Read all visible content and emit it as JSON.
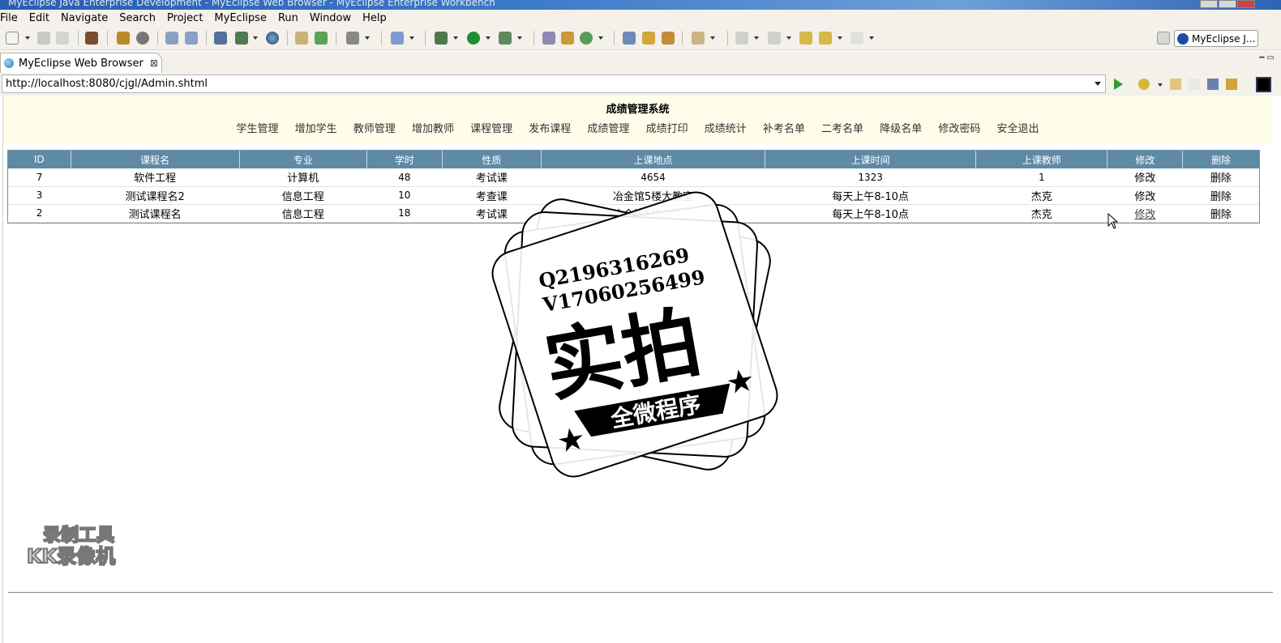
{
  "window": {
    "title": "MyEclipse Java Enterprise Development - MyEclipse Web Browser - MyEclipse Enterprise Workbench"
  },
  "menu": [
    "File",
    "Edit",
    "Navigate",
    "Search",
    "Project",
    "MyEclipse",
    "Run",
    "Window",
    "Help"
  ],
  "perspective": {
    "label": "MyEclipse J..."
  },
  "editor_tab": {
    "label": "MyEclipse Web Browser",
    "close": "⊠"
  },
  "address": {
    "url": "http://localhost:8080/cjgl/Admin.shtml"
  },
  "page": {
    "title": "成绩管理系统",
    "nav": [
      "学生管理",
      "增加学生",
      "教师管理",
      "增加教师",
      "课程管理",
      "发布课程",
      "成绩管理",
      "成绩打印",
      "成绩统计",
      "补考名单",
      "二考名单",
      "降级名单",
      "修改密码",
      "安全退出"
    ]
  },
  "table": {
    "headers": [
      "ID",
      "课程名",
      "专业",
      "学时",
      "性质",
      "上课地点",
      "上课时间",
      "上课教师",
      "修改",
      "删除"
    ],
    "rows": [
      {
        "id": "7",
        "name": "软件工程",
        "major": "计算机",
        "hours": "48",
        "type": "考试课",
        "place": "4654",
        "time": "1323",
        "teacher": "1",
        "edit": "修改",
        "del": "删除"
      },
      {
        "id": "3",
        "name": "测试课程名2",
        "major": "信息工程",
        "hours": "10",
        "type": "考查课",
        "place": "冶金馆5楼大教室",
        "time": "每天上午8-10点",
        "teacher": "杰克",
        "edit": "修改",
        "del": "删除"
      },
      {
        "id": "2",
        "name": "测试课程名",
        "major": "信息工程",
        "hours": "18",
        "type": "考试课",
        "place": "冶金馆5楼大教室",
        "time": "每天上午8-10点",
        "teacher": "杰克",
        "edit": "修改",
        "del": "删除"
      }
    ]
  },
  "stamp": {
    "line1": "Q2196316269",
    "line2": "V17060256499",
    "main": "实拍",
    "banner": "全微程序"
  },
  "watermark": {
    "line1": "录制工具",
    "line2": "KK录像机"
  }
}
